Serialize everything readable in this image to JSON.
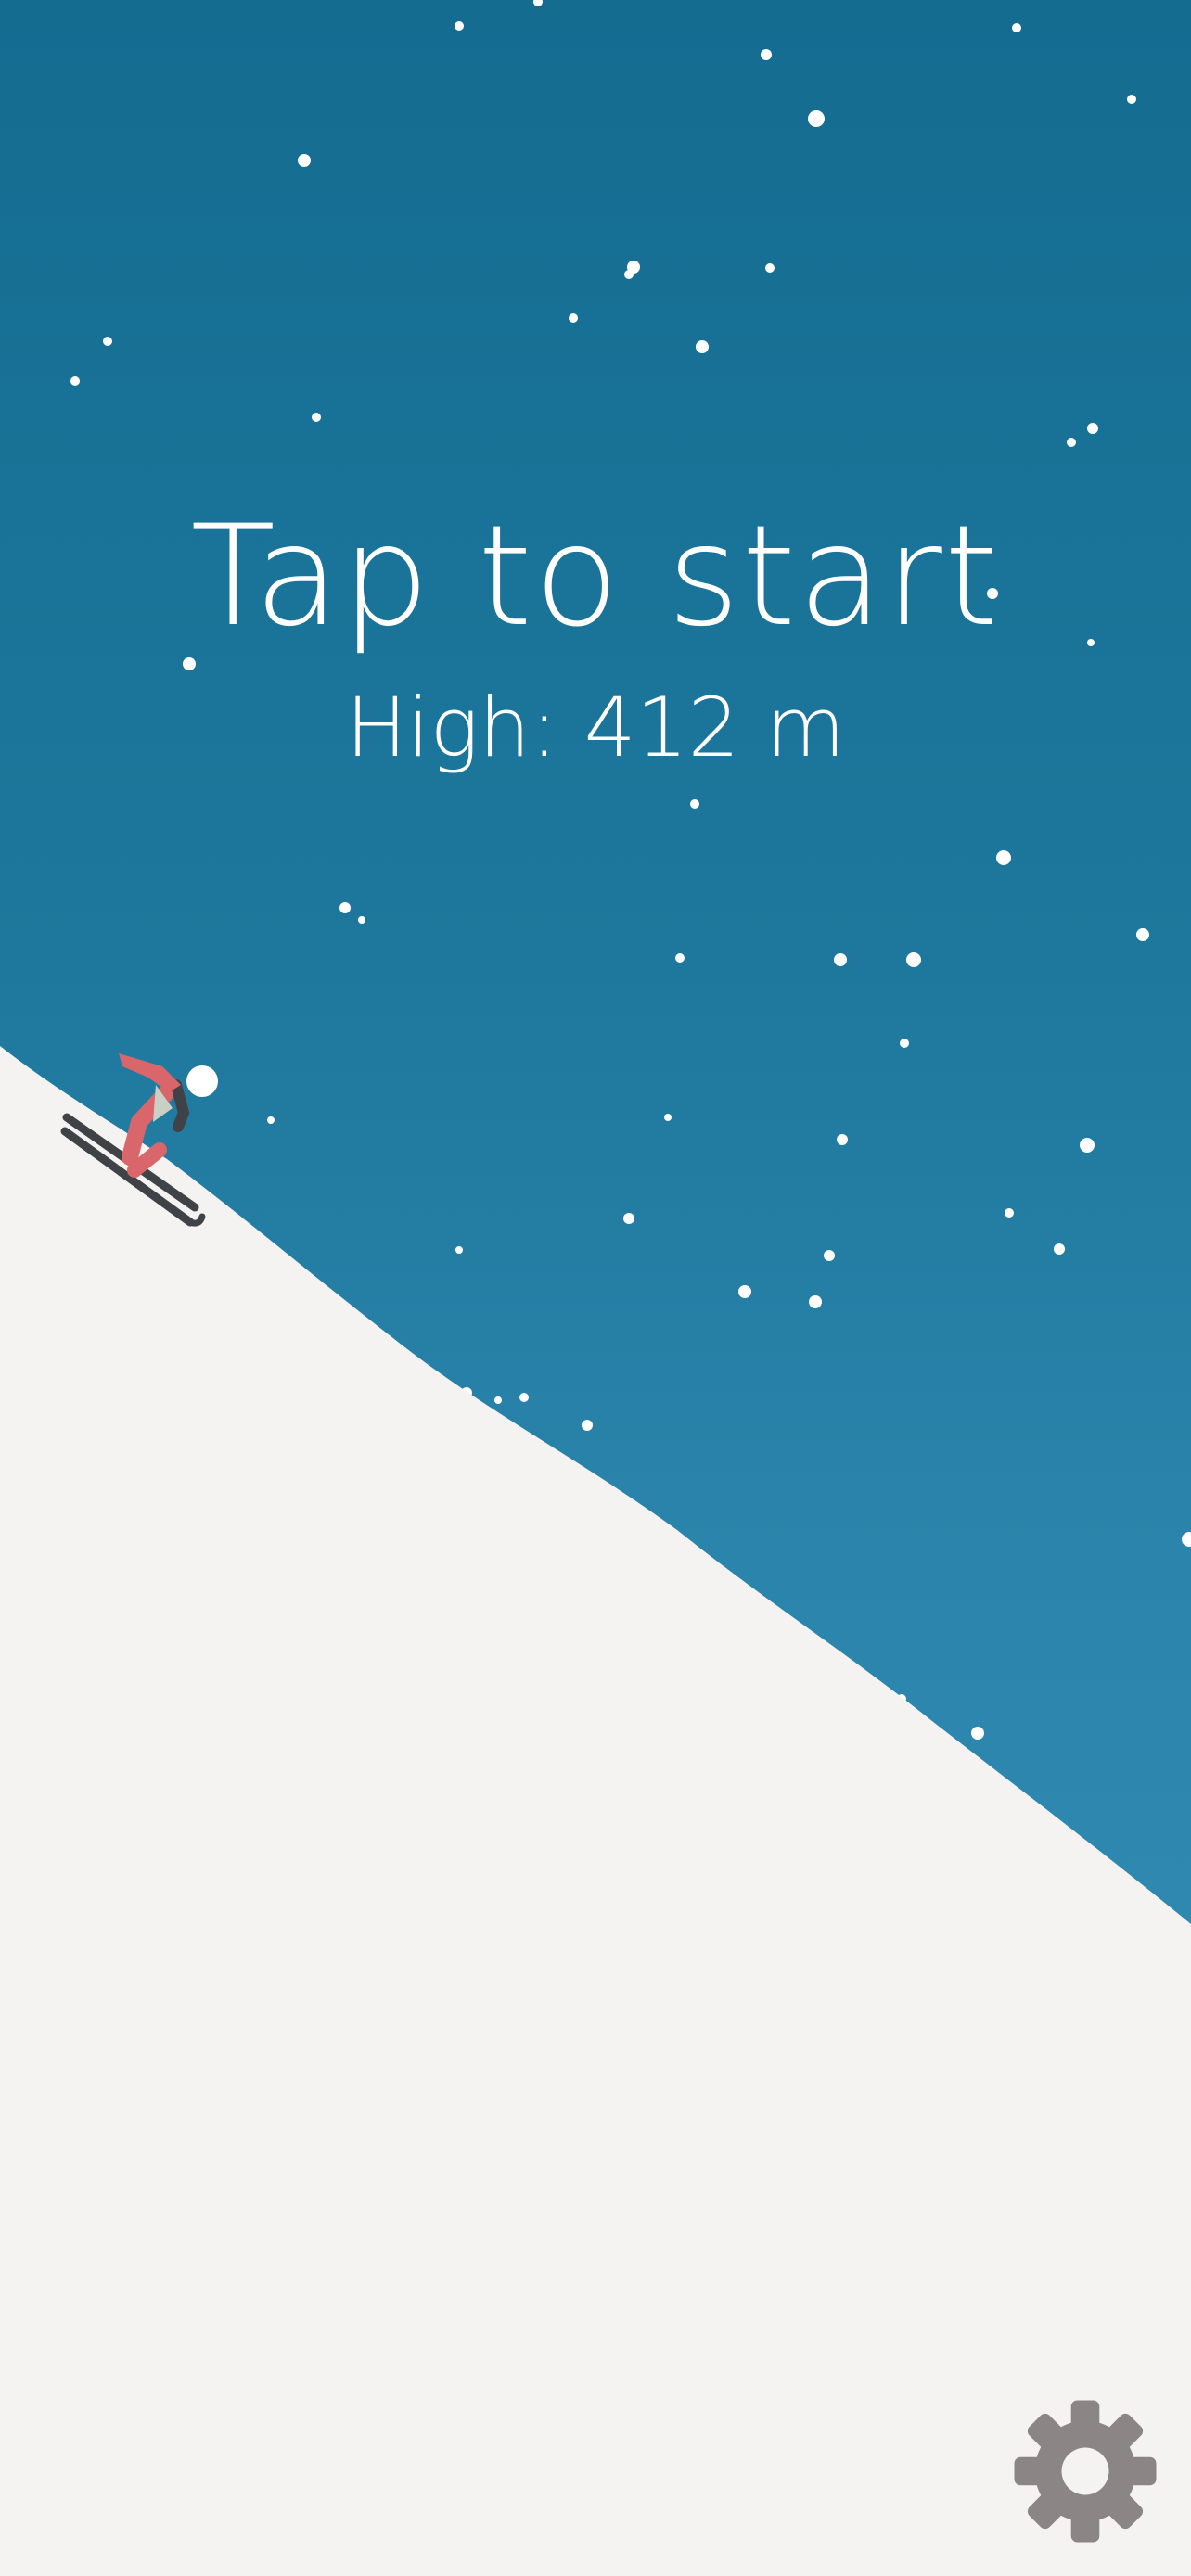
{
  "game": {
    "title": "Tap to start",
    "high_label": "High:",
    "high_value": "412 m"
  },
  "controls": {
    "settings_icon": "gear-icon"
  },
  "colors": {
    "sky_top": "#146c91",
    "sky_bottom": "#358fb7",
    "snow": "#f4f3f1",
    "skier_scarf": "#d9666b",
    "skier_body": "#c9d1c4",
    "skis": "#3f4348",
    "gear": "#8b8586",
    "text": "#ffffff"
  }
}
